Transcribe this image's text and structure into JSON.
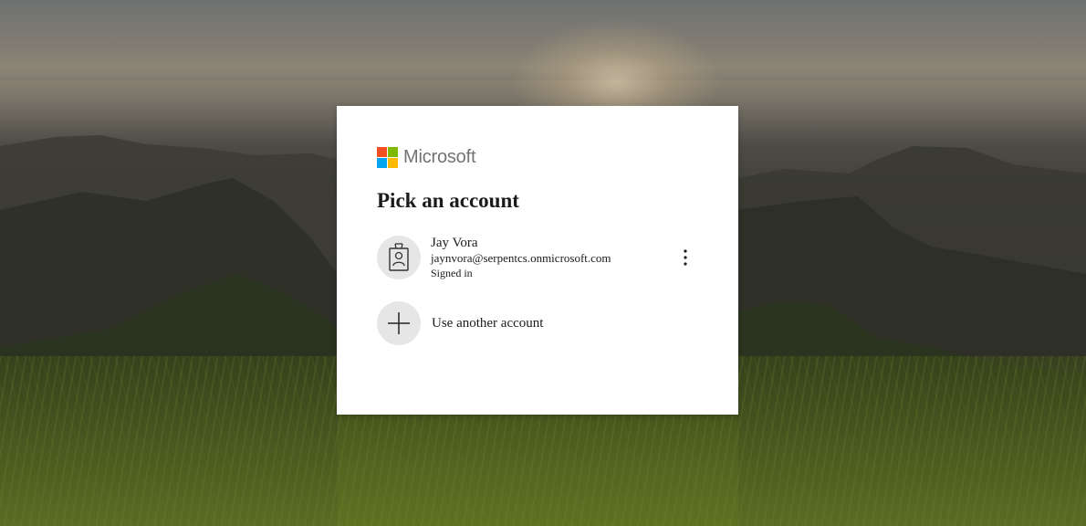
{
  "brand": {
    "name": "Microsoft",
    "colors": [
      "#f25022",
      "#7fba00",
      "#00a4ef",
      "#ffb900"
    ]
  },
  "dialog": {
    "title": "Pick an account",
    "accounts": [
      {
        "name": "Jay Vora",
        "email": "jaynvora@serpentcs.onmicrosoft.com",
        "status": "Signed in",
        "icon": "badge-person-icon",
        "options_icon": "more-options-icon"
      }
    ],
    "use_another": {
      "label": "Use another account",
      "icon": "plus-icon"
    }
  }
}
